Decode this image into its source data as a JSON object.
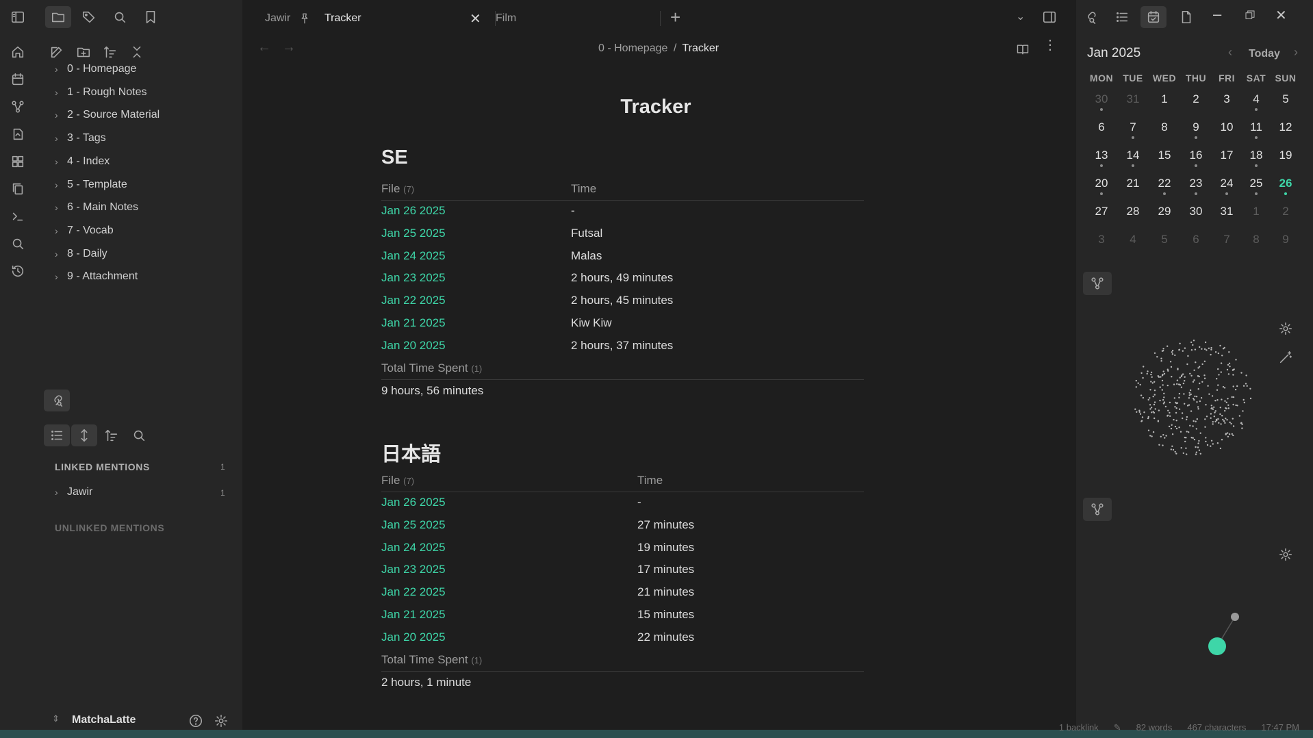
{
  "tabs": [
    {
      "label": "Jawir",
      "pinned": true
    },
    {
      "label": "Tracker",
      "active": true
    },
    {
      "label": "Film"
    }
  ],
  "breadcrumb": {
    "parent": "0 - Homepage",
    "separator": "/",
    "current": "Tracker"
  },
  "file_tree": [
    "0 - Homepage",
    "1 - Rough Notes",
    "2 - Source Material",
    "3 - Tags",
    "4 - Index",
    "5 - Template",
    "6 - Main Notes",
    "7 - Vocab",
    "8 - Daily",
    "9 - Attachment"
  ],
  "backlinks": {
    "linked_title": "LINKED MENTIONS",
    "linked_count": "1",
    "linked_items": [
      {
        "label": "Jawir",
        "count": "1"
      }
    ],
    "unlinked_title": "UNLINKED MENTIONS"
  },
  "vault": {
    "name": "MatchaLatte"
  },
  "note": {
    "title": "Tracker",
    "sections": [
      {
        "heading": "SE",
        "col_file": "File",
        "file_count": "(7)",
        "col_time": "Time",
        "rows": [
          {
            "file": "Jan 26 2025",
            "time": "-"
          },
          {
            "file": "Jan 25 2025",
            "time": "Futsal"
          },
          {
            "file": "Jan 24 2025",
            "time": "Malas"
          },
          {
            "file": "Jan 23 2025",
            "time": "2 hours, 49 minutes"
          },
          {
            "file": "Jan 22 2025",
            "time": "2 hours, 45 minutes"
          },
          {
            "file": "Jan 21 2025",
            "time": "Kiw Kiw"
          },
          {
            "file": "Jan 20 2025",
            "time": "2 hours, 37 minutes"
          }
        ],
        "total_label": "Total Time Spent",
        "total_count": "(1)",
        "total_value": "9 hours, 56 minutes"
      },
      {
        "heading": "日本語",
        "col_file": "File",
        "file_count": "(7)",
        "col_time": "Time",
        "rows": [
          {
            "file": "Jan 26 2025",
            "time": "-"
          },
          {
            "file": "Jan 25 2025",
            "time": "27 minutes"
          },
          {
            "file": "Jan 24 2025",
            "time": "19 minutes"
          },
          {
            "file": "Jan 23 2025",
            "time": "17 minutes"
          },
          {
            "file": "Jan 22 2025",
            "time": "21 minutes"
          },
          {
            "file": "Jan 21 2025",
            "time": "15 minutes"
          },
          {
            "file": "Jan 20 2025",
            "time": "22 minutes"
          }
        ],
        "total_label": "Total Time Spent",
        "total_count": "(1)",
        "total_value": "2 hours, 1 minute"
      }
    ]
  },
  "calendar": {
    "month": "Jan 2025",
    "today_label": "Today",
    "weekdays": [
      "MON",
      "TUE",
      "WED",
      "THU",
      "FRI",
      "SAT",
      "SUN"
    ],
    "weeks": [
      [
        "30",
        "31",
        "1",
        "2",
        "3",
        "4",
        "5"
      ],
      [
        "6",
        "7",
        "8",
        "9",
        "10",
        "11",
        "12"
      ],
      [
        "13",
        "14",
        "15",
        "16",
        "17",
        "18",
        "19"
      ],
      [
        "20",
        "21",
        "22",
        "23",
        "24",
        "25",
        "26"
      ],
      [
        "27",
        "28",
        "29",
        "30",
        "31",
        "1",
        "2"
      ],
      [
        "3",
        "4",
        "5",
        "6",
        "7",
        "8",
        "9"
      ]
    ],
    "today": "26"
  },
  "status_bar": {
    "backlinks": "1 backlink",
    "words": "82 words",
    "characters": "467 characters",
    "time": "17:47 PM"
  },
  "colors": {
    "accent": "#3ed6a8",
    "background": "#1e1e1e",
    "sidebar": "#262626",
    "statusbar": "#2b4f4f"
  }
}
